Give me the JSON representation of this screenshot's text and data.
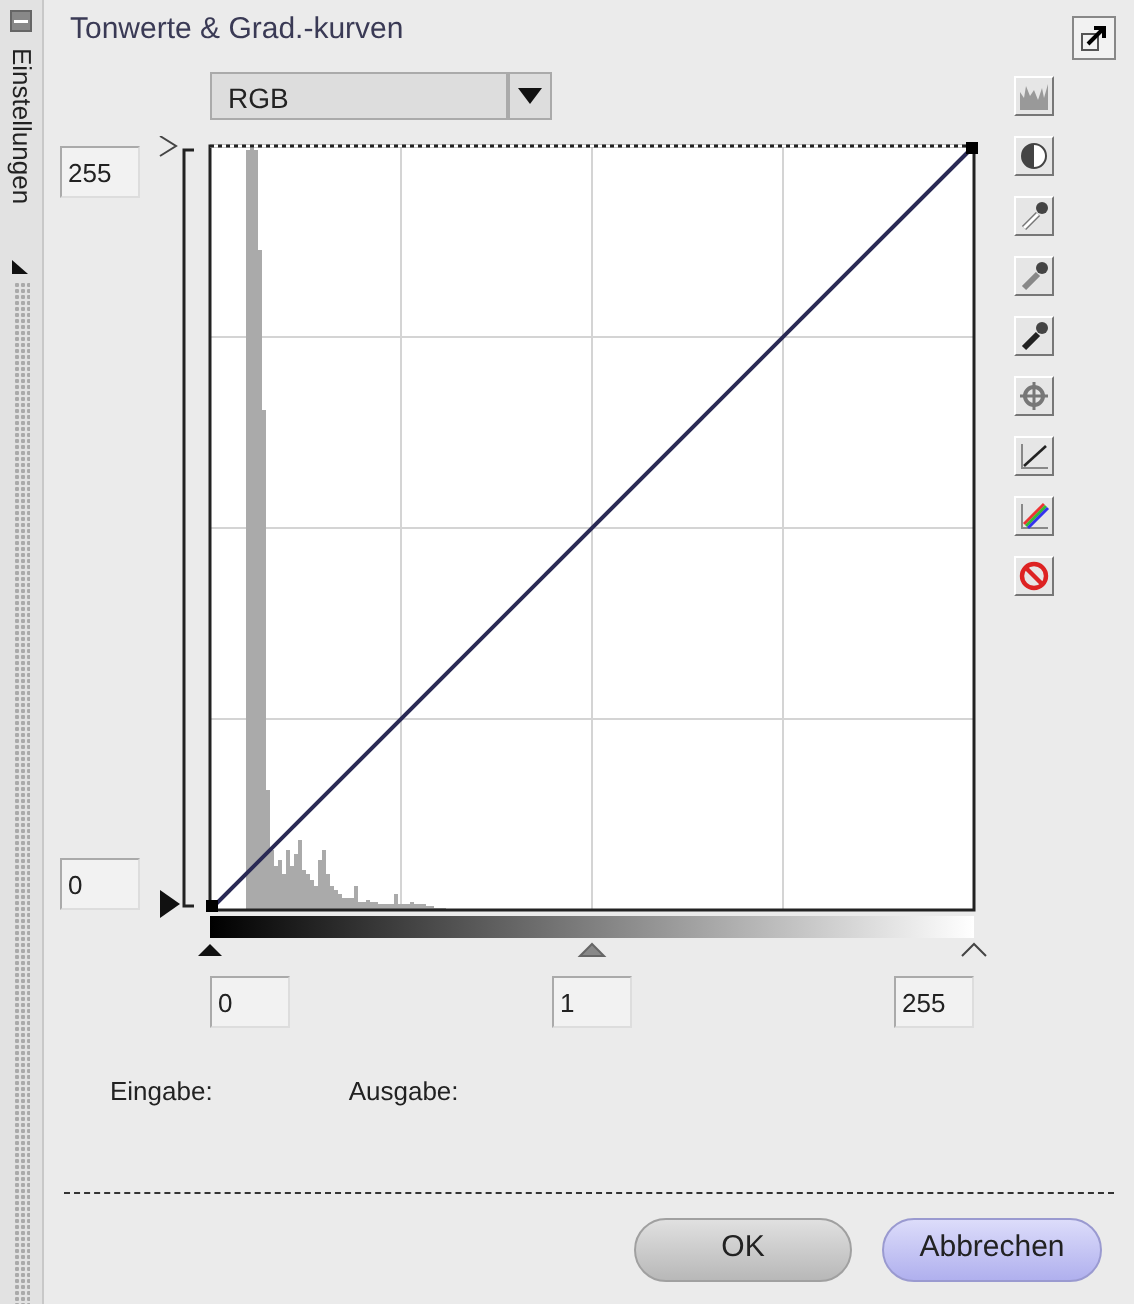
{
  "side_tab": {
    "label": "Einstellungen"
  },
  "panel": {
    "title": "Tonwerte & Grad.-kurven"
  },
  "channel": {
    "value": "RGB"
  },
  "output": {
    "max": "255",
    "min": "0"
  },
  "input": {
    "black": "0",
    "gamma": "1",
    "white": "255"
  },
  "readouts": [
    {
      "label": "Eingabe:"
    },
    {
      "label": "Ausgabe:"
    }
  ],
  "tools": [
    {
      "kind": "histogram"
    },
    {
      "kind": "contrast"
    },
    {
      "kind": "white-picker"
    },
    {
      "kind": "grey-picker"
    },
    {
      "kind": "black-picker"
    },
    {
      "kind": "crosshair"
    },
    {
      "kind": "linear"
    },
    {
      "kind": "rgb-curves"
    },
    {
      "kind": "reset"
    }
  ],
  "buttons": [
    {
      "label": "OK",
      "kind": "default"
    },
    {
      "label": "Abbrechen",
      "kind": "primary"
    }
  ]
}
